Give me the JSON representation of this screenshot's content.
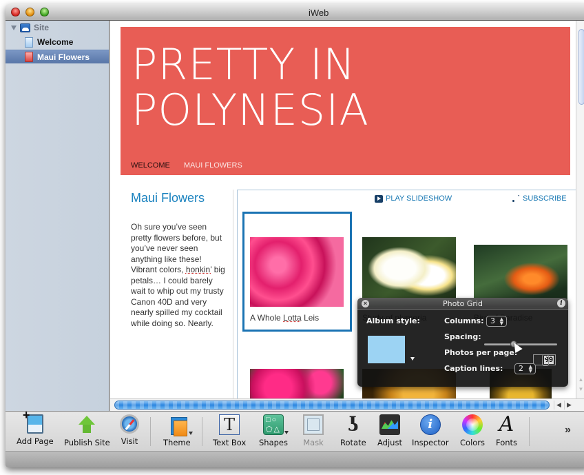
{
  "window": {
    "title": "iWeb"
  },
  "sidebar": {
    "site_label": "Site",
    "pages": [
      {
        "label": "Welcome",
        "selected": false
      },
      {
        "label": "Maui Flowers",
        "selected": true
      }
    ]
  },
  "page": {
    "site_title_line1": "PRETTY IN",
    "site_title_line2": "POLYNESIA",
    "nav": [
      {
        "label": "WELCOME",
        "current": true
      },
      {
        "label": "MAUI FLOWERS",
        "current": false
      }
    ],
    "heading": "Maui Flowers",
    "body_text_parts": [
      "Oh sure you’ve seen pretty flowers before, but you’ve never seen anything like these! Vibrant colors, ",
      "honkin’",
      " big petals… I could barely wait to whip out my trusty Canon 40D and very nearly spilled my cocktail while doing so. Nearly."
    ],
    "play_slideshow": "PLAY SLIDESHOW",
    "subscribe": "SUBSCRIBE",
    "photos": [
      {
        "caption_parts": [
          "A Whole ",
          "Lotta",
          " Leis"
        ],
        "selected": true
      },
      {
        "caption": "Study of plumeria",
        "selected": false
      },
      {
        "caption": "Bird of Paradise",
        "selected": false
      },
      {
        "caption": "",
        "selected": false
      },
      {
        "caption": "",
        "selected": false
      },
      {
        "caption": "",
        "selected": false
      }
    ]
  },
  "photo_grid_hud": {
    "title": "Photo Grid",
    "album_style_label": "Album style:",
    "album_style_color": "#9cd3f3",
    "columns_label": "Columns:",
    "columns_value": "3",
    "spacing_label": "Spacing:",
    "spacing_fraction": 0.4,
    "photos_per_page_label": "Photos per page:",
    "photos_per_page_value": "99",
    "caption_lines_label": "Caption lines:",
    "caption_lines_value": "2"
  },
  "toolbar": {
    "items": [
      {
        "label": "Add Page",
        "icon": "add-page-icon"
      },
      {
        "label": "Publish Site",
        "icon": "publish-icon"
      },
      {
        "label": "Visit",
        "icon": "compass-icon"
      },
      {
        "label": "Theme",
        "icon": "theme-icon"
      },
      {
        "label": "Text Box",
        "icon": "text-box-icon"
      },
      {
        "label": "Shapes",
        "icon": "shapes-icon"
      },
      {
        "label": "Mask",
        "icon": "mask-icon",
        "disabled": true
      },
      {
        "label": "Rotate",
        "icon": "rotate-icon"
      },
      {
        "label": "Adjust",
        "icon": "adjust-icon"
      },
      {
        "label": "Inspector",
        "icon": "inspector-icon"
      },
      {
        "label": "Colors",
        "icon": "color-wheel-icon"
      },
      {
        "label": "Fonts",
        "icon": "fonts-icon"
      }
    ],
    "overflow": "»"
  },
  "colors": {
    "header_band": "#e85d55",
    "accent_blue": "#1a82bf",
    "selection_border": "#1a73b3"
  }
}
